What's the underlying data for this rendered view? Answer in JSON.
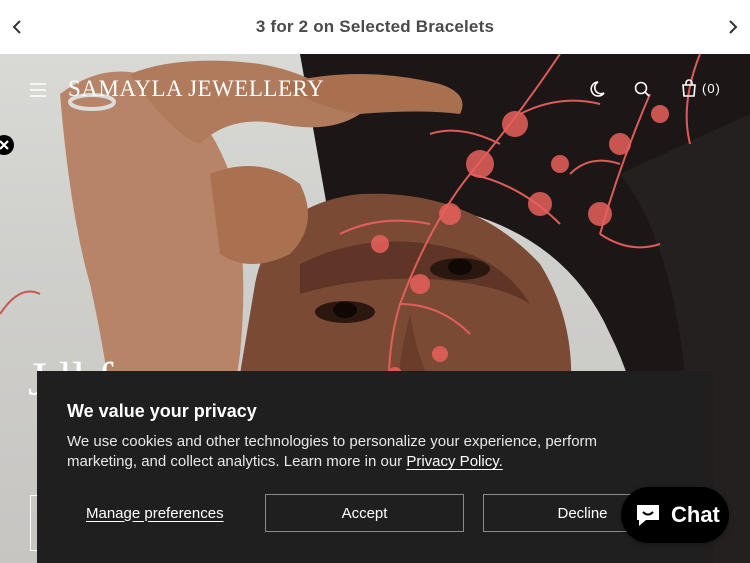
{
  "announcement": {
    "text": "3 for 2 on Selected Bracelets",
    "prev_icon": "chevron-left-icon",
    "next_icon": "chevron-right-icon"
  },
  "header": {
    "logo": "SAMAYLA JEWELLERY",
    "menu_icon": "hamburger-menu-icon",
    "theme_icon": "moon-icon",
    "search_icon": "search-icon",
    "cart_icon": "shopping-bag-icon",
    "cart_count": "(0)"
  },
  "hero": {
    "heading_fragment": "J  ll  f",
    "close_icon": "close-icon"
  },
  "cookie": {
    "title": "We value your privacy",
    "body": "We use cookies and other technologies to personalize your experience, perform marketing, and collect analytics. Learn more in our ",
    "link": "Privacy Policy.",
    "manage_label": "Manage preferences",
    "accept_label": "Accept",
    "decline_label": "Decline"
  },
  "chat": {
    "label": "Chat",
    "icon": "chat-bubble-icon"
  },
  "colors": {
    "banner_bg": "#1f1f1f",
    "chat_bg": "#000000",
    "accent_foliage": "#e8605c"
  }
}
